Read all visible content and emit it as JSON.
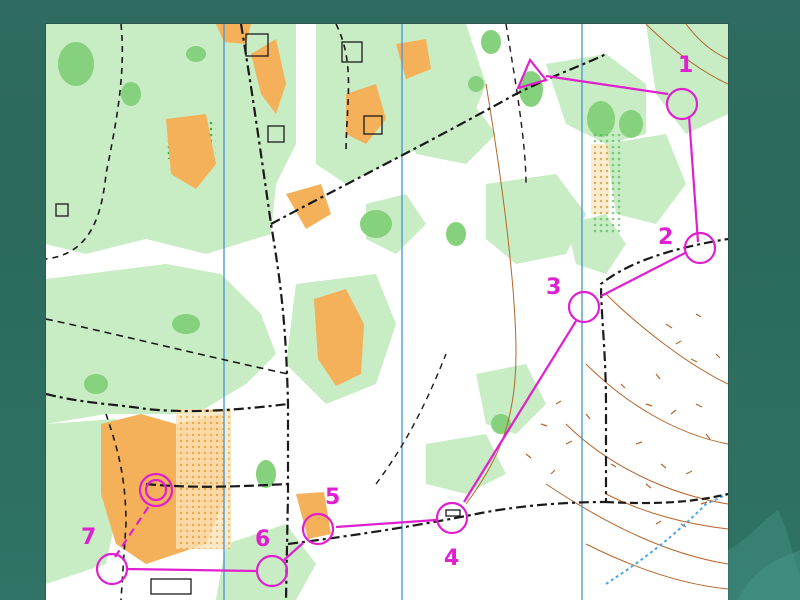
{
  "map": {
    "colors": {
      "open_land": "#f4b15a",
      "vegetation": "#c5ebc0",
      "vegetation_dark": "#83d07a",
      "north_lines": "#4f9ad8",
      "track": "#1a1a1a",
      "contours": "#b5652a",
      "course": "#e01fd0"
    },
    "course": {
      "controls": [
        {
          "number": "1"
        },
        {
          "number": "2"
        },
        {
          "number": "3"
        },
        {
          "number": "4"
        },
        {
          "number": "5"
        },
        {
          "number": "6"
        },
        {
          "number": "7"
        }
      ]
    }
  }
}
